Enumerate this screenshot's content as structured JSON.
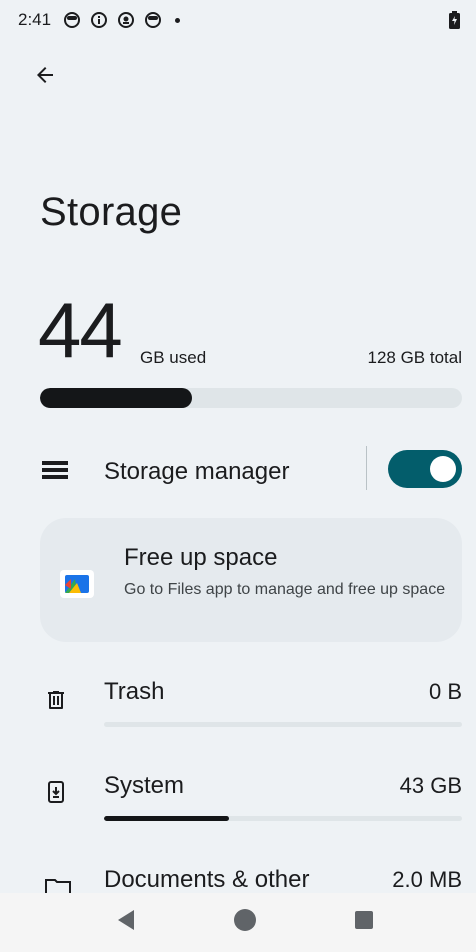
{
  "status_bar": {
    "time": "2:41",
    "icons": [
      "notification-circle-icon",
      "info-icon",
      "location-icon",
      "notification-circle-icon"
    ],
    "battery_icon": "battery-charging-icon"
  },
  "header": {
    "back_icon": "back-arrow-icon",
    "title": "Storage"
  },
  "usage": {
    "used_value": "44",
    "used_unit": "GB used",
    "total_label": "128 GB total",
    "used_fraction": 0.36
  },
  "storage_manager": {
    "icon": "list-icon",
    "label": "Storage manager",
    "enabled": true
  },
  "free_up_card": {
    "icon": "files-app-icon",
    "title": "Free up space",
    "description": "Go to Files app to manage and free up space"
  },
  "categories": [
    {
      "icon": "trash-icon",
      "label": "Trash",
      "value": "0 B",
      "fraction": 0.0
    },
    {
      "icon": "system-download-icon",
      "label": "System",
      "value": "43 GB",
      "fraction": 0.35
    },
    {
      "icon": "folder-icon",
      "label": "Documents & other",
      "value": "2.0 MB",
      "fraction": 0.0
    }
  ],
  "nav": {
    "back_icon": "nav-back-triangle-icon",
    "home_icon": "nav-home-circle-icon",
    "recents_icon": "nav-recents-square-icon"
  },
  "colors": {
    "background": "#eef2f5",
    "accent": "#035d6b",
    "bar_fill": "#141618",
    "bar_track": "#dfe5e8"
  }
}
